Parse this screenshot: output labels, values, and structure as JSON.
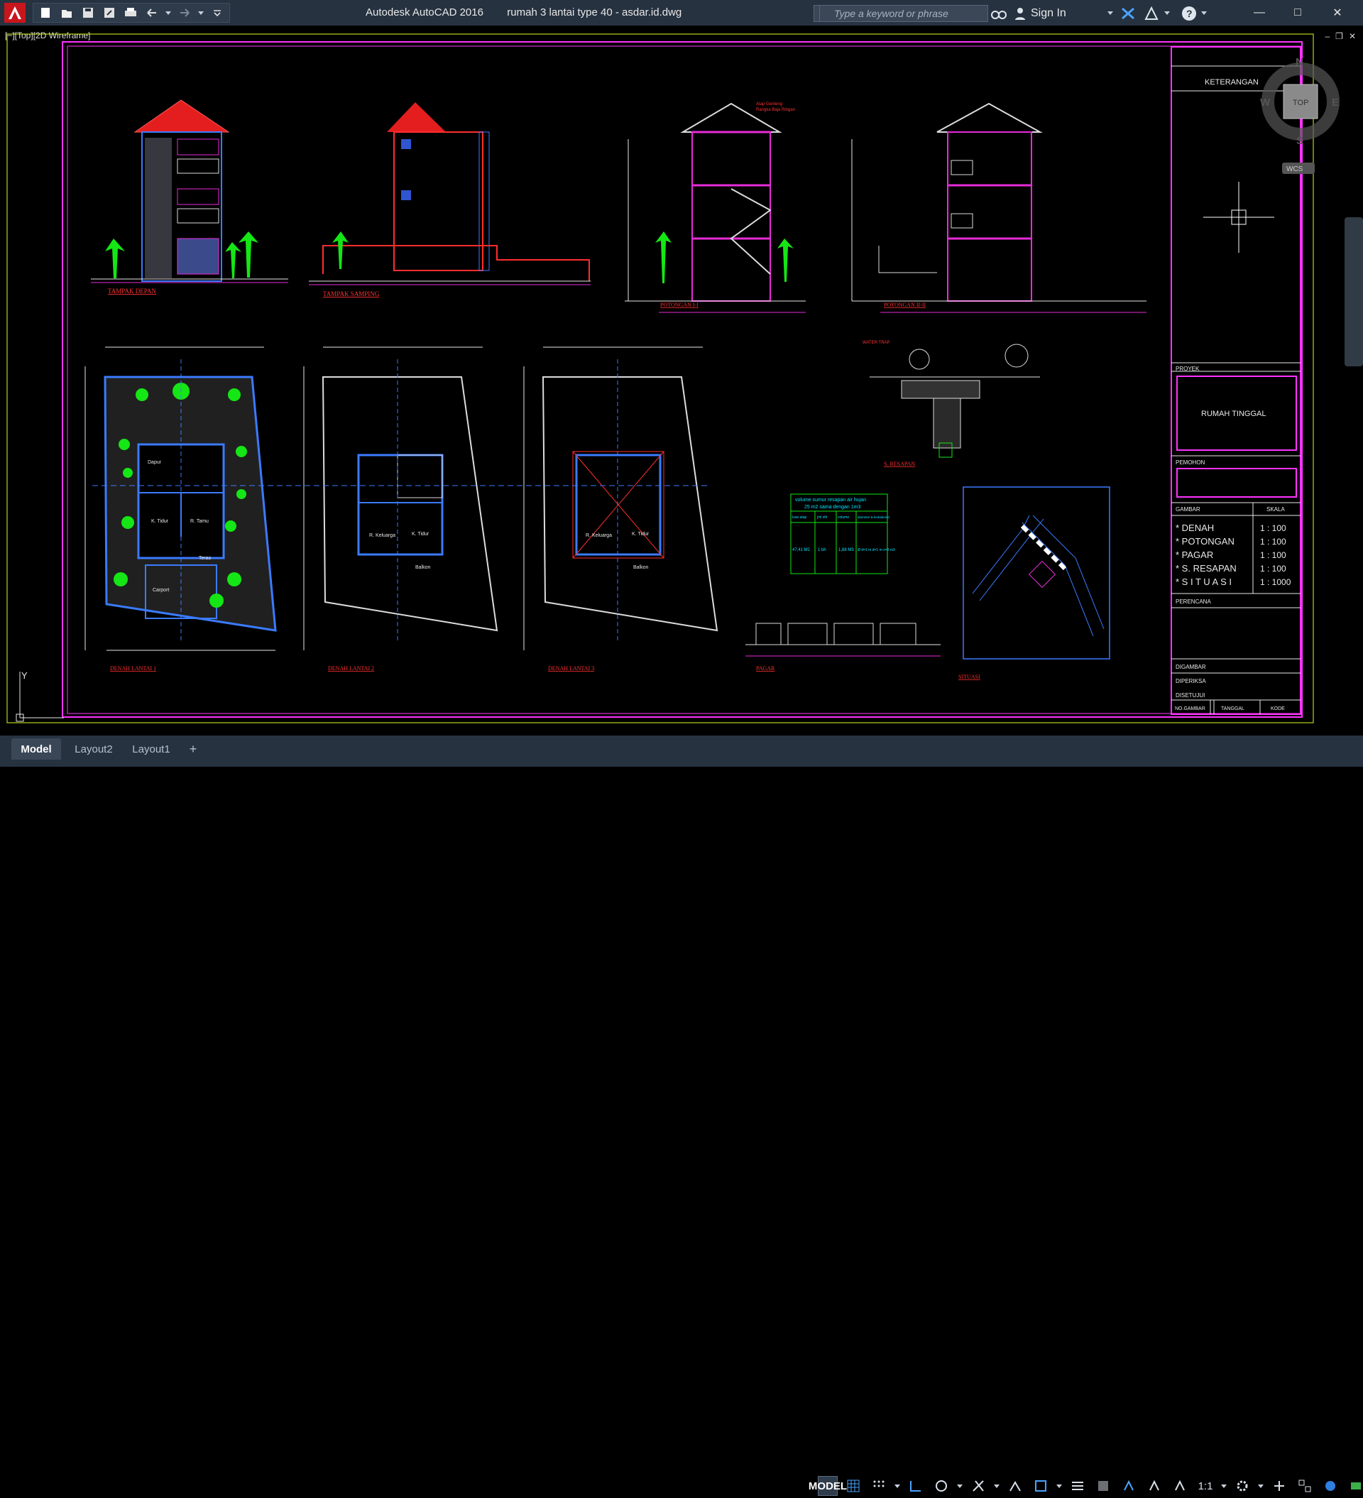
{
  "titlebar": {
    "app_name": "Autodesk AutoCAD 2016",
    "file_name": "rumah 3 lantai type 40 - asdar.id.dwg",
    "search_placeholder": "Type a keyword or phrase",
    "signin_label": "Sign In"
  },
  "viewport": {
    "label": "[−][Top][2D Wireframe]",
    "compass": {
      "north": "N",
      "south": "S",
      "east": "E",
      "west": "W",
      "top": "TOP",
      "wcs": "WCS"
    },
    "ucs_y": "Y"
  },
  "drawings": {
    "elevations": [
      "TAMPAK DEPAN",
      "TAMPAK SAMPING",
      "POTONGAN I-I",
      "POTONGAN II-II"
    ],
    "plans": [
      "DENAH LANTAI 1",
      "DENAH LANTAI 2",
      "DENAH LANTAI 3"
    ],
    "details": [
      "S. RESAPAN",
      "PAGAR",
      "SITUASI"
    ],
    "room_labels": [
      "Dapur",
      "K. Tidur",
      "R. Tamu",
      "R. Keluarga",
      "K. Tidur",
      "Balkon",
      "Teras",
      "Carport"
    ],
    "resapan_table": {
      "title": "volume sumur resapan air hujan",
      "subtitle": "25 m2 sama dengan 1m3",
      "headers": [
        "luas atap",
        "jml sth",
        "volume",
        "diameter & kedalaman"
      ],
      "row": [
        "47,41 M2",
        "1 bh",
        "1,88 M3",
        "Ø d=1 m  d=1 m  v=3 m3"
      ]
    },
    "roof_note_1": "Atap Genteng",
    "roof_note_2": "Rangka Baja Ringan",
    "water_trap": "WATER TRAP"
  },
  "title_block": {
    "header": "KETERANGAN",
    "proyek_label": "PROYEK",
    "proyek_value": "RUMAH TINGGAL",
    "pemohon_label": "PEMOHON",
    "gambar_label": "GAMBAR",
    "skala_label": "SKALA",
    "rows": [
      {
        "name": "* DENAH",
        "scale": "1 : 100"
      },
      {
        "name": "* POTONGAN",
        "scale": "1 : 100"
      },
      {
        "name": "* PAGAR",
        "scale": "1 : 100"
      },
      {
        "name": "* S. RESAPAN",
        "scale": "1 : 100"
      },
      {
        "name": "* S I T U A S I",
        "scale": "1 : 1000"
      }
    ],
    "perencana_label": "PERENCANA",
    "digambar_label": "DIGAMBAR",
    "diperiksa_label": "DIPERIKSA",
    "disetujui_label": "DISETUJUI",
    "no_gambar_label": "NO.GAMBAR",
    "tanggal_label": "TANGGAL",
    "kode_label": "KODE"
  },
  "tabs": [
    "Model",
    "Layout2",
    "Layout1"
  ],
  "status": {
    "model_label": "MODEL",
    "scale_label": "1:1"
  },
  "colors": {
    "titlebar": "#263240",
    "drawing_bg": "#000000",
    "frame": "#ff33ff",
    "accent": "#2f7fe0"
  }
}
